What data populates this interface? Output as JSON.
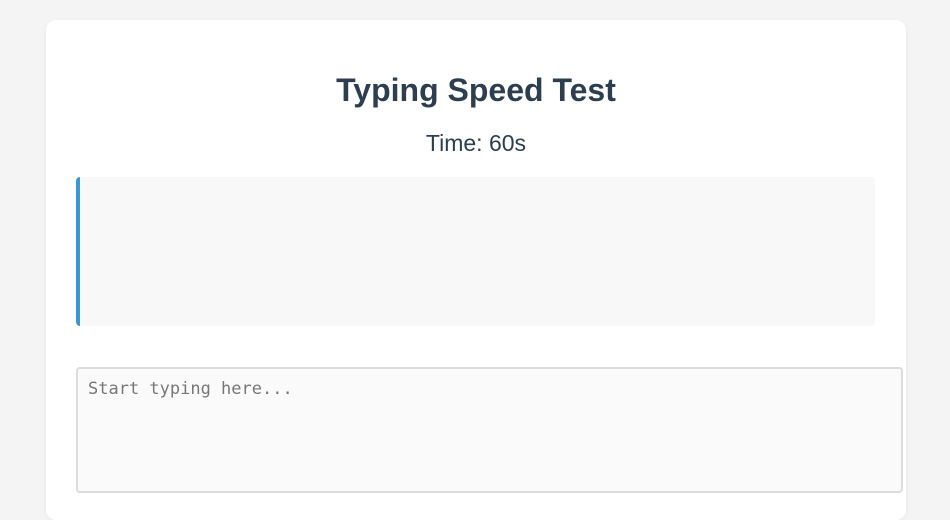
{
  "app": {
    "title": "Typing Speed Test"
  },
  "timer": {
    "label": "Time: ",
    "value": "60s"
  },
  "text_display": {
    "text": ""
  },
  "input": {
    "value": "",
    "placeholder": "Start typing here..."
  },
  "colors": {
    "accent": "#3498db",
    "heading": "#2c3e50",
    "page_background": "#f4f4f4",
    "card_background": "#ffffff",
    "display_background": "#f8f8f8"
  }
}
